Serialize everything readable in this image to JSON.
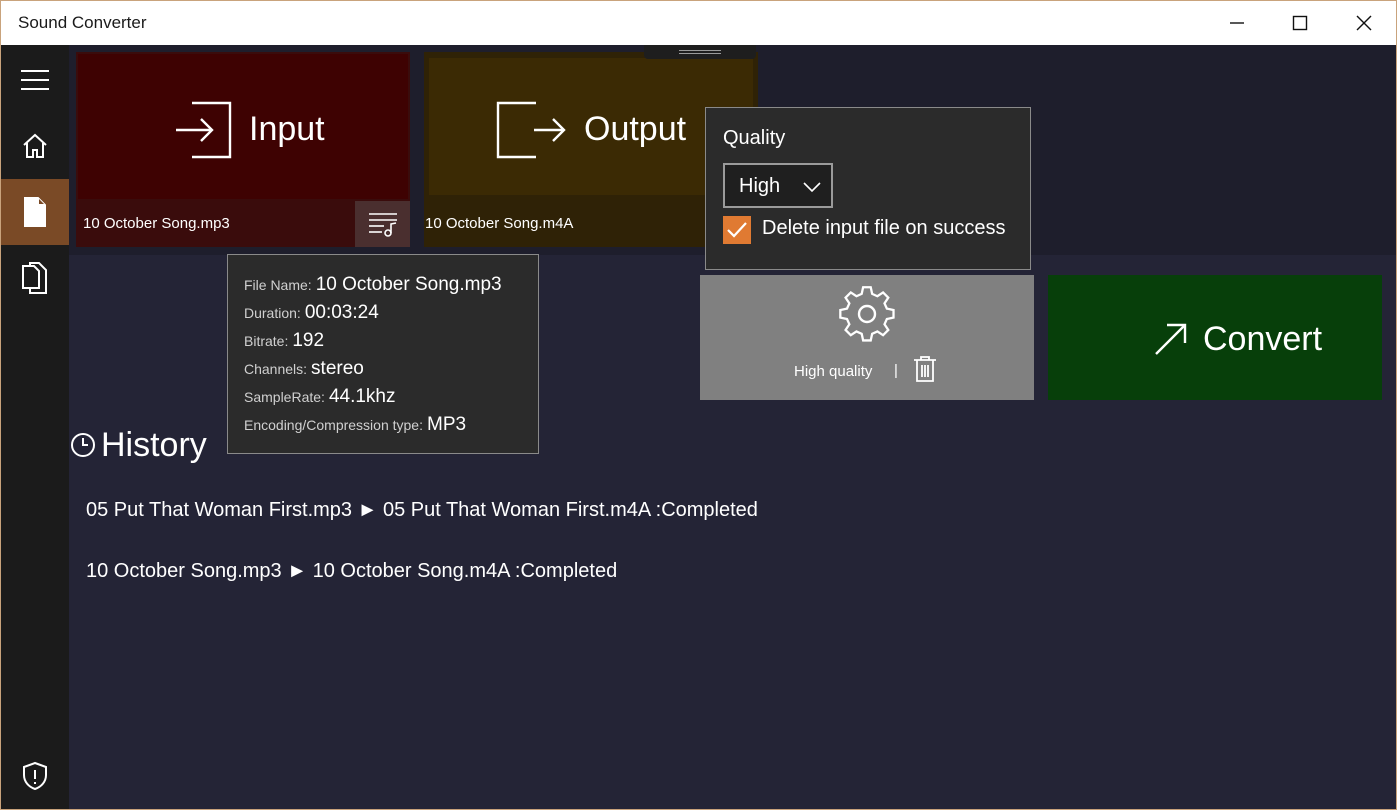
{
  "window": {
    "title": "Sound Converter",
    "accent": "#7a4a26"
  },
  "titlebar_buttons": {
    "minimize_icon": "minimize-icon",
    "maximize_icon": "maximize-icon",
    "close_icon": "close-icon"
  },
  "sidebar": {
    "items": [
      {
        "icon": "hamburger-menu-icon"
      },
      {
        "icon": "home-icon"
      },
      {
        "icon": "document-icon",
        "active": true
      },
      {
        "icon": "copy-documents-icon"
      },
      {
        "icon": "shield-icon"
      }
    ]
  },
  "input_tile": {
    "label": "Input",
    "file": "10 October Song.mp3",
    "color": "#3e0202"
  },
  "output_tile": {
    "label": "Output",
    "file": "10 October Song.m4A",
    "color": "#3b2a04"
  },
  "file_info": {
    "rows": [
      {
        "key": "File Name:",
        "value": "10 October Song.mp3"
      },
      {
        "key": "Duration:",
        "value": "00:03:24"
      },
      {
        "key": "Bitrate:",
        "value": "192"
      },
      {
        "key": "Channels:",
        "value": "stereo"
      },
      {
        "key": "SampleRate:",
        "value": "44.1khz"
      },
      {
        "key": "Encoding/Compression type:",
        "value": "MP3"
      }
    ]
  },
  "quality_flyout": {
    "title": "Quality",
    "selected": "High",
    "delete_label": "Delete input file on success",
    "delete_checked": true,
    "checkbox_color": "#e07a32"
  },
  "settings_tile": {
    "summary": "High  quality",
    "separator": "|",
    "color": "#808080"
  },
  "convert_tile": {
    "label": "Convert",
    "color": "#073f0a"
  },
  "history": {
    "title": "History",
    "items": [
      "05 Put That Woman First.mp3 ► 05 Put That Woman First.m4A :Completed",
      "10 October Song.mp3 ► 10 October Song.m4A :Completed"
    ]
  }
}
